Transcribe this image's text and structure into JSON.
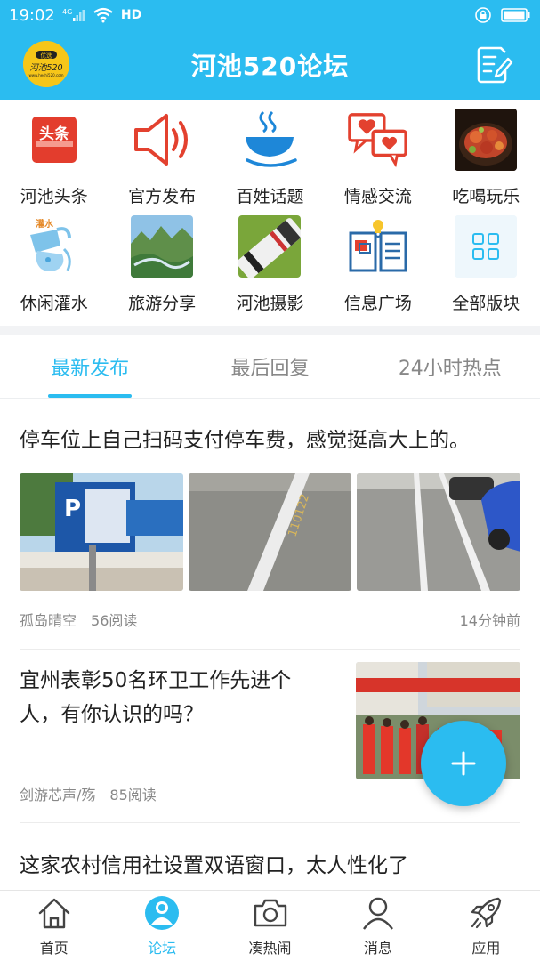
{
  "status_bar": {
    "time": "19:02",
    "network": "4G",
    "hd": "HD"
  },
  "header": {
    "title": "河池520论坛",
    "logo_text": "优选 河池520"
  },
  "categories": [
    {
      "label": "河池头条",
      "icon": "news-icon",
      "badge": "头条"
    },
    {
      "label": "官方发布",
      "icon": "megaphone-icon"
    },
    {
      "label": "百姓话题",
      "icon": "tea-cup-icon"
    },
    {
      "label": "情感交流",
      "icon": "chat-hearts-icon"
    },
    {
      "label": "吃喝玩乐",
      "icon": "food-icon"
    },
    {
      "label": "休闲灌水",
      "icon": "water-icon"
    },
    {
      "label": "旅游分享",
      "icon": "landscape-icon"
    },
    {
      "label": "河池摄影",
      "icon": "camera-lens-icon"
    },
    {
      "label": "信息广场",
      "icon": "info-board-icon"
    },
    {
      "label": "全部版块",
      "icon": "grid-icon"
    }
  ],
  "tabs": [
    {
      "label": "最新发布",
      "active": true
    },
    {
      "label": "最后回复",
      "active": false
    },
    {
      "label": "24小时热点",
      "active": false
    }
  ],
  "posts": [
    {
      "title": "停车位上自己扫码支付停车费，感觉挺高大上的。",
      "author": "孤岛晴空",
      "reads": "56阅读",
      "time": "14分钟前"
    },
    {
      "title": "宜州表彰50名环卫工作先进个人，有你认识的吗？",
      "author": "剑游芯声/殇",
      "reads": "85阅读"
    },
    {
      "title": "这家农村信用社设置双语窗口，太人性化了"
    }
  ],
  "bottom_nav": [
    {
      "label": "首页",
      "icon": "home-icon",
      "active": false
    },
    {
      "label": "论坛",
      "icon": "forum-icon",
      "active": true
    },
    {
      "label": "凑热闹",
      "icon": "camera-icon",
      "active": false
    },
    {
      "label": "消息",
      "icon": "user-icon",
      "active": false
    },
    {
      "label": "应用",
      "icon": "rocket-icon",
      "active": false
    }
  ],
  "colors": {
    "primary": "#2bbcf0",
    "text": "#222222",
    "muted": "#888888"
  }
}
